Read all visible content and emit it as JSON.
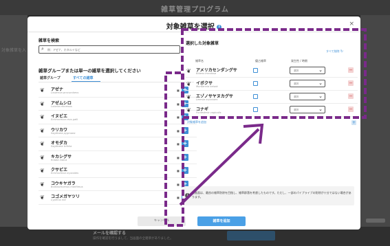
{
  "app": {
    "title": "雑草管理プログラム"
  },
  "modal": {
    "title": "対象雑草を選択",
    "close_label": "×",
    "search": {
      "label": "雑草を検索",
      "placeholder": "例：アゼナ、ホタルイなど"
    },
    "group_heading": "雑草グループまたは単一の雑草を選択してください",
    "tabs": [
      {
        "label": "雑草グループ"
      },
      {
        "label": "すべての雑草"
      }
    ],
    "weeds": [
      {
        "jp": "アゼナ",
        "latin": "Lindernia procumbens"
      },
      {
        "jp": "アゼムシロ",
        "latin": "Lobelia chinensis"
      },
      {
        "jp": "イヌビエ",
        "latin": "Echinochloa crus-galli"
      },
      {
        "jp": "ウリカワ",
        "latin": "Sagittaria pygmaea"
      },
      {
        "jp": "オモダカ",
        "latin": "Sagittaria trifolia"
      },
      {
        "jp": "キカシグサ",
        "latin": "Rotala indica"
      },
      {
        "jp": "クサビエ",
        "latin": "Echinochloa oryzoides"
      },
      {
        "jp": "コウキヤガラ",
        "latin": "Bolboschoenus maritimus"
      },
      {
        "jp": "コゴメガヤツリ",
        "latin": "Cyperus iria"
      }
    ],
    "selected_panel": {
      "title": "選択した対象雑草",
      "reset_label": "すべて削除",
      "columns": {
        "name": "雑草名",
        "flag": "優占雑草",
        "state": "発生性 / 時期"
      },
      "rows": [
        {
          "jp": "アメリカセンダングサ",
          "latin": "Bidens frondosa",
          "select": "選択"
        },
        {
          "jp": "イボクサ",
          "latin": "Murdannia keisak",
          "select": "選択"
        },
        {
          "jp": "エゾノサヤヌカグサ",
          "latin": "Leersia oryzoides",
          "select": "選択"
        },
        {
          "jp": "コナギ",
          "latin": "Pontederia vaginalis",
          "select": "選択"
        }
      ],
      "clear_label": "対象雑草を追加"
    },
    "notice": "当画面は、最良の雑草防除を目指し、雑草群落を考慮したものです。ただし、一部のパイプライブの防除が十分ではない場合があります。",
    "buttons": {
      "cancel": "キャンセル",
      "add": "雑草を追加"
    }
  },
  "background": {
    "left_label": "対象雑草を入",
    "bottom_title": "メールを確認する",
    "bottom_sub": "操作を確認を行うまして、当画面の全雑草がありました。"
  },
  "colors": {
    "accent": "#3d8fd6",
    "annotation": "#7a2a8a"
  }
}
